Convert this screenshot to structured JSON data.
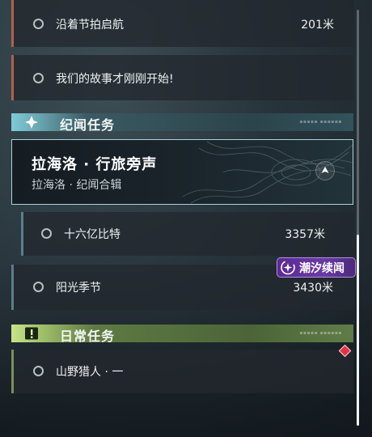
{
  "quests_top": [
    {
      "title": "沿着节拍启航",
      "distance": "201米"
    },
    {
      "title": "我们的故事才刚刚开始!",
      "distance": ""
    }
  ],
  "category_story": {
    "title": "纪闻任务",
    "icon": "sparkle-icon",
    "color": "#7fc9d8"
  },
  "featured_quest": {
    "title": "拉海洛 · 行旅旁声",
    "subtitle": "拉海洛 · 纪闻合辑"
  },
  "story_quests": [
    {
      "title": "十六亿比特",
      "distance": "3357米"
    },
    {
      "title": "阳光季节",
      "distance": "3430米"
    }
  ],
  "event_badge": {
    "label": "潮汐续闻",
    "color": "#6a3aa6"
  },
  "category_daily": {
    "title": "日常任务",
    "icon": "exclamation-box-icon",
    "color": "#a5c46d"
  },
  "daily_quests": [
    {
      "title": "山野猎人 · 一",
      "distance": ""
    }
  ]
}
